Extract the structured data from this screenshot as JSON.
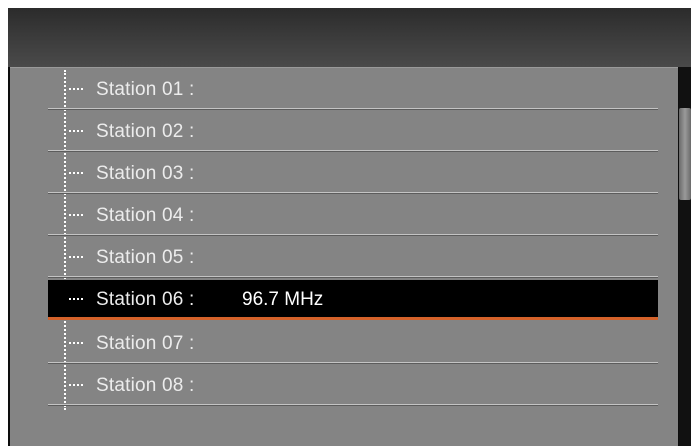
{
  "station_list": {
    "items": [
      {
        "label": "Station 01 :",
        "frequency": ""
      },
      {
        "label": "Station 02 :",
        "frequency": ""
      },
      {
        "label": "Station 03 :",
        "frequency": ""
      },
      {
        "label": "Station 04 :",
        "frequency": ""
      },
      {
        "label": "Station 05 :",
        "frequency": ""
      },
      {
        "label": "Station 06 :",
        "frequency": "96.7 MHz",
        "selected": true
      },
      {
        "label": "Station 07 :",
        "frequency": ""
      },
      {
        "label": "Station 08 :",
        "frequency": ""
      }
    ]
  },
  "colors": {
    "panel_bg": "#848484",
    "selected_bg": "#000000",
    "selected_underline": "#d4622a",
    "text": "#ececec"
  }
}
